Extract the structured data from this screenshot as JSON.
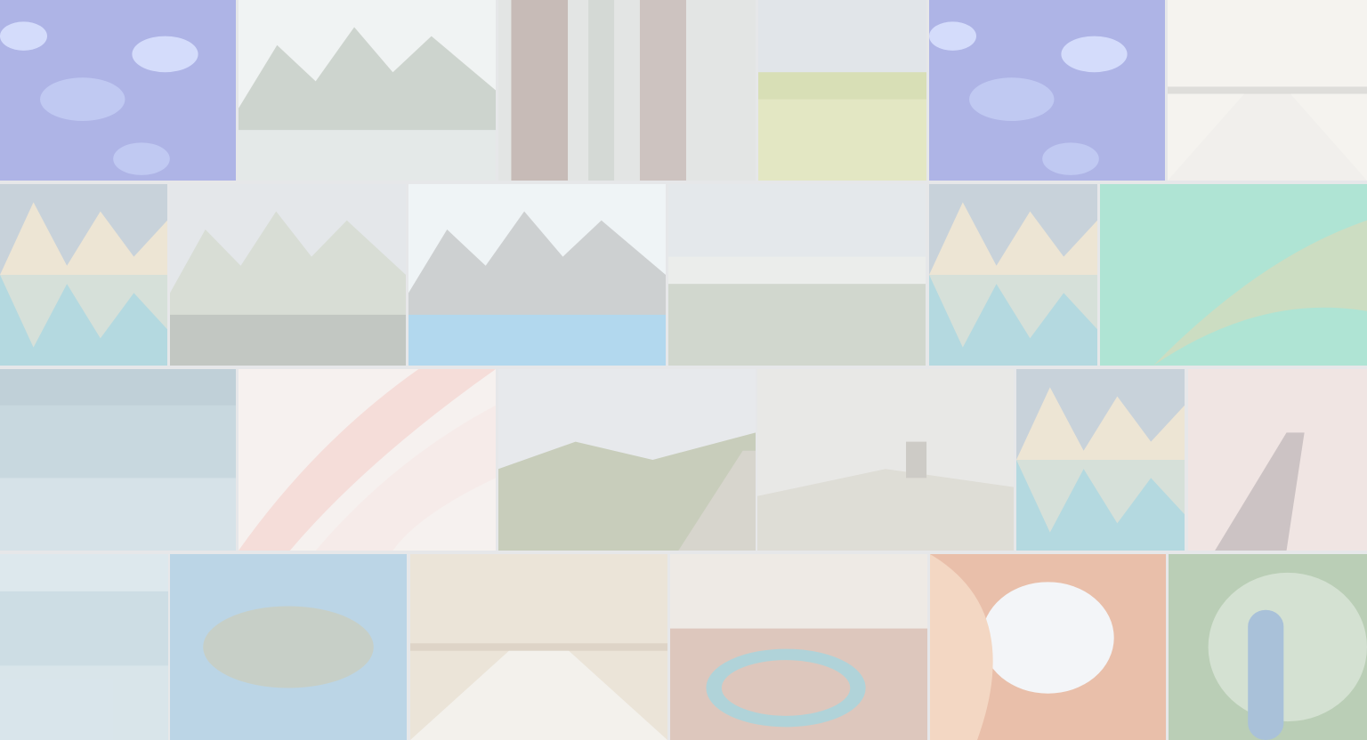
{
  "gallery": {
    "tiles": [
      {
        "id": "jellyfish",
        "colors": [
          "#3b49c9",
          "#6b7fe8",
          "#9fb0ff"
        ]
      },
      {
        "id": "alpine-valley",
        "colors": [
          "#c9d3cc",
          "#8d9b8a",
          "#e8ece9"
        ]
      },
      {
        "id": "redwood-forest",
        "colors": [
          "#7d5a4c",
          "#9fa89c",
          "#c4c9c2"
        ]
      },
      {
        "id": "grassland",
        "colors": [
          "#a8b84a",
          "#d1d67a",
          "#c0c9cf"
        ]
      },
      {
        "id": "jellyfish",
        "colors": [
          "#3b49c9",
          "#6b7fe8",
          "#9fb0ff"
        ]
      },
      {
        "id": "palm-road",
        "colors": [
          "#e9e3d8",
          "#f3ede0",
          "#b9b4a8"
        ]
      },
      {
        "id": "lake-reflection",
        "colors": [
          "#4aa8b7",
          "#e0c79a",
          "#7e96a8"
        ]
      },
      {
        "id": "mountain-ridge",
        "colors": [
          "#6e7a6a",
          "#a8b29c",
          "#c8ced2"
        ]
      },
      {
        "id": "moraine-lake",
        "colors": [
          "#46a6dd",
          "#8d9090",
          "#e5eef2"
        ]
      },
      {
        "id": "foggy-valley",
        "colors": [
          "#d9dcd6",
          "#7b8a6a",
          "#c8cfd6"
        ]
      },
      {
        "id": "lake-reflection",
        "colors": [
          "#4aa8b7",
          "#e0c79a",
          "#7e96a8"
        ]
      },
      {
        "id": "kelp-leaf",
        "colors": [
          "#3ec49a",
          "#88b36a",
          "#b9dfc9"
        ]
      },
      {
        "id": "night-sky",
        "colors": [
          "#7ea6b6",
          "#a3c1cd",
          "#5f8594"
        ]
      },
      {
        "id": "pink-petal",
        "colors": [
          "#f4b2a6",
          "#f8d8cf",
          "#f6e7e0"
        ]
      },
      {
        "id": "road-landscape",
        "colors": [
          "#7f8a58",
          "#a79d86",
          "#cfd3d8"
        ]
      },
      {
        "id": "elk-hills",
        "colors": [
          "#b9b29f",
          "#d3d0c8",
          "#8d8574"
        ]
      },
      {
        "id": "lake-reflection",
        "colors": [
          "#4aa8b7",
          "#e0c79a",
          "#7e96a8"
        ]
      },
      {
        "id": "pier-sunset",
        "colors": [
          "#c78c8a",
          "#e8c7c1",
          "#8a6f6f"
        ]
      },
      {
        "id": "underwater",
        "colors": [
          "#8bb2c2",
          "#aac8d3",
          "#d3e4ea"
        ]
      },
      {
        "id": "island-aerial",
        "colors": [
          "#5e9fc8",
          "#e9f1f4",
          "#7d8f78"
        ]
      },
      {
        "id": "bright-boardwalk",
        "colors": [
          "#efe7d8",
          "#d9c5a4",
          "#b79b77"
        ]
      },
      {
        "id": "horseshoe-bend",
        "colors": [
          "#b67a5c",
          "#3f9aa7",
          "#e2d6c4"
        ]
      },
      {
        "id": "antelope-canyon",
        "colors": [
          "#d6642b",
          "#f0a46c",
          "#eef2f6"
        ]
      },
      {
        "id": "peacock",
        "colors": [
          "#2d6aa7",
          "#5a8d4a",
          "#cde0c6"
        ]
      }
    ]
  }
}
